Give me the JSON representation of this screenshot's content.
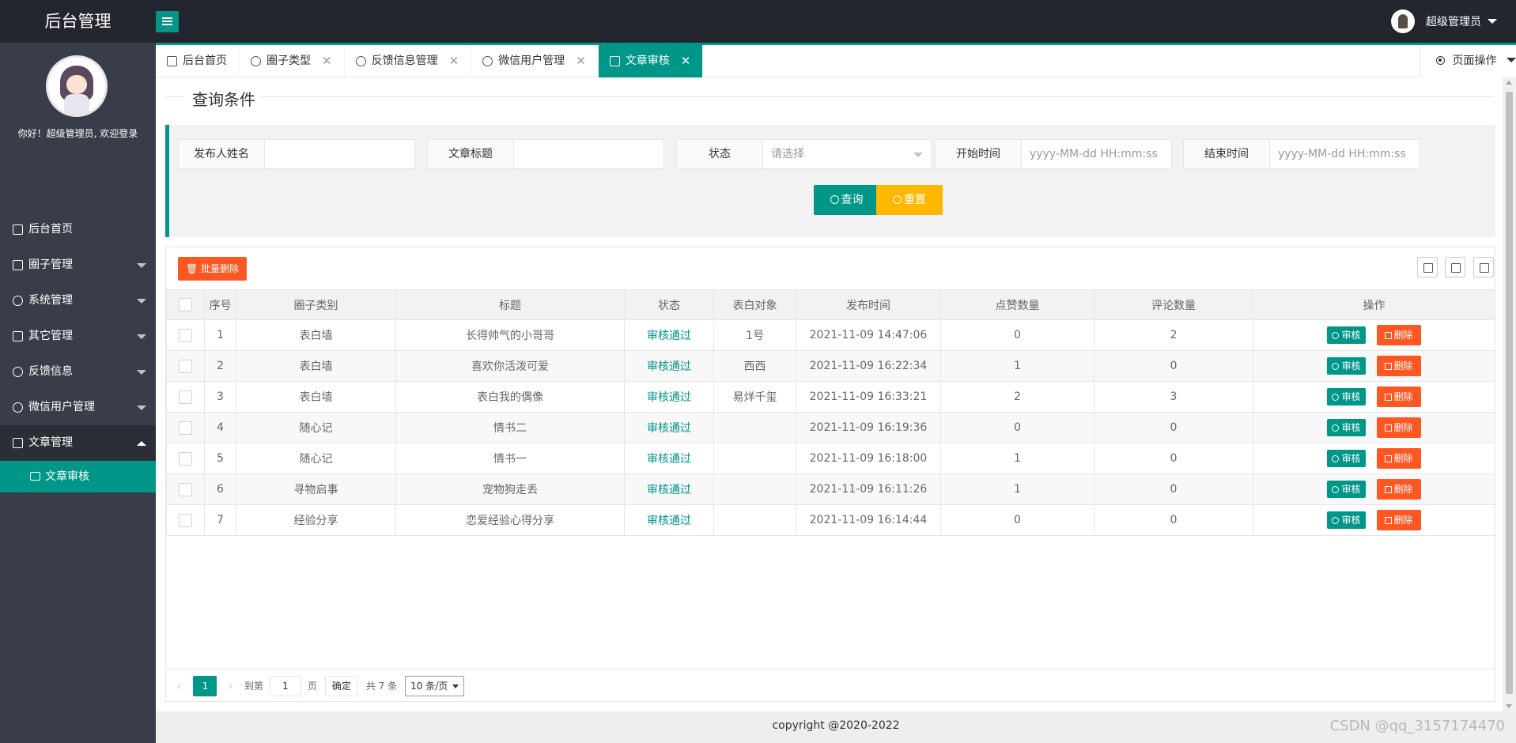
{
  "header": {
    "logo": "后台管理",
    "user_name": "超级管理员"
  },
  "sidebar": {
    "welcome": "你好！超级管理员, 欢迎登录",
    "items": [
      {
        "label": "后台首页",
        "icon": "home-icon",
        "has_arrow": false
      },
      {
        "label": "圈子管理",
        "icon": "cube-icon",
        "has_arrow": true
      },
      {
        "label": "系统管理",
        "icon": "gear-icon",
        "has_arrow": true
      },
      {
        "label": "其它管理",
        "icon": "clipboard-icon",
        "has_arrow": true
      },
      {
        "label": "反馈信息",
        "icon": "weibo-icon",
        "has_arrow": true
      },
      {
        "label": "微信用户管理",
        "icon": "pause-icon",
        "has_arrow": true
      },
      {
        "label": "文章管理",
        "icon": "cart-icon",
        "has_arrow": true,
        "open": true
      }
    ],
    "active_child": {
      "label": "文章审核",
      "icon": "image-icon"
    }
  },
  "tabs": [
    {
      "label": "后台首页",
      "icon": "home-icon",
      "closable": false
    },
    {
      "label": "圈子类型",
      "icon": "user-icon",
      "closable": true
    },
    {
      "label": "反馈信息管理",
      "icon": "weibo-icon",
      "closable": true
    },
    {
      "label": "微信用户管理",
      "icon": "person-icon",
      "closable": true
    },
    {
      "label": "文章审核",
      "icon": "image-icon",
      "closable": true,
      "active": true
    }
  ],
  "page_ops": "页面操作",
  "search": {
    "legend": "查询条件",
    "fields": [
      {
        "label": "发布人姓名",
        "value": "",
        "placeholder": ""
      },
      {
        "label": "文章标题",
        "value": "",
        "placeholder": ""
      },
      {
        "label": "状态",
        "value": "",
        "placeholder": "请选择",
        "select": true
      },
      {
        "label": "开始时间",
        "value": "",
        "placeholder": "yyyy-MM-dd HH:mm:ss"
      },
      {
        "label": "结束时间",
        "value": "",
        "placeholder": "yyyy-MM-dd HH:mm:ss"
      }
    ],
    "query_label": "查询",
    "reset_label": "重置"
  },
  "table": {
    "batch_delete_label": "批量删除",
    "columns": [
      "",
      "序号",
      "圈子类别",
      "标题",
      "状态",
      "表白对象",
      "发布时间",
      "点赞数量",
      "评论数量",
      "操作"
    ],
    "rows": [
      {
        "no": "1",
        "category": "表白墙",
        "title": "长得帅气的小哥哥",
        "status": "审核通过",
        "target": "1号",
        "time": "2021-11-09 14:47:06",
        "likes": "0",
        "comments": "2"
      },
      {
        "no": "2",
        "category": "表白墙",
        "title": "喜欢你活泼可爱",
        "status": "审核通过",
        "target": "西西",
        "time": "2021-11-09 16:22:34",
        "likes": "1",
        "comments": "0"
      },
      {
        "no": "3",
        "category": "表白墙",
        "title": "表白我的偶像",
        "status": "审核通过",
        "target": "易烊千玺",
        "time": "2021-11-09 16:33:21",
        "likes": "2",
        "comments": "3"
      },
      {
        "no": "4",
        "category": "随心记",
        "title": "情书二",
        "status": "审核通过",
        "target": "",
        "time": "2021-11-09 16:19:36",
        "likes": "0",
        "comments": "0"
      },
      {
        "no": "5",
        "category": "随心记",
        "title": "情书一",
        "status": "审核通过",
        "target": "",
        "time": "2021-11-09 16:18:00",
        "likes": "1",
        "comments": "0"
      },
      {
        "no": "6",
        "category": "寻物启事",
        "title": "宠物狗走丢",
        "status": "审核通过",
        "target": "",
        "time": "2021-11-09 16:11:26",
        "likes": "1",
        "comments": "0"
      },
      {
        "no": "7",
        "category": "经验分享",
        "title": "恋爱经验心得分享",
        "status": "审核通过",
        "target": "",
        "time": "2021-11-09 16:14:44",
        "likes": "0",
        "comments": "0"
      }
    ],
    "review_label": "审核",
    "delete_label": "删除"
  },
  "pager": {
    "current": "1",
    "goto_label": "到第",
    "goto_value": "1",
    "page_unit": "页",
    "confirm_label": "确定",
    "total": "共 7 条",
    "page_size": "10 条/页"
  },
  "footer": "copyright @2020-2022",
  "watermark": "CSDN @qq_3157174470",
  "colors": {
    "accent": "#009688",
    "danger": "#ff5722",
    "warning": "#ffb800",
    "dark": "#23262e",
    "sidebar": "#393d49"
  }
}
